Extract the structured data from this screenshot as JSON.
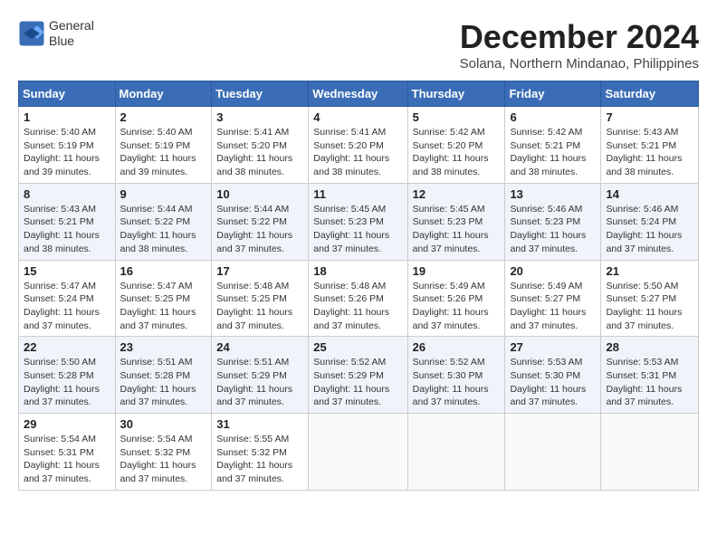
{
  "header": {
    "logo_line1": "General",
    "logo_line2": "Blue",
    "month_year": "December 2024",
    "location": "Solana, Northern Mindanao, Philippines"
  },
  "calendar": {
    "headers": [
      "Sunday",
      "Monday",
      "Tuesday",
      "Wednesday",
      "Thursday",
      "Friday",
      "Saturday"
    ],
    "weeks": [
      [
        {
          "day": "",
          "info": ""
        },
        {
          "day": "2",
          "info": "Sunrise: 5:40 AM\nSunset: 5:19 PM\nDaylight: 11 hours\nand 39 minutes."
        },
        {
          "day": "3",
          "info": "Sunrise: 5:41 AM\nSunset: 5:20 PM\nDaylight: 11 hours\nand 38 minutes."
        },
        {
          "day": "4",
          "info": "Sunrise: 5:41 AM\nSunset: 5:20 PM\nDaylight: 11 hours\nand 38 minutes."
        },
        {
          "day": "5",
          "info": "Sunrise: 5:42 AM\nSunset: 5:20 PM\nDaylight: 11 hours\nand 38 minutes."
        },
        {
          "day": "6",
          "info": "Sunrise: 5:42 AM\nSunset: 5:21 PM\nDaylight: 11 hours\nand 38 minutes."
        },
        {
          "day": "7",
          "info": "Sunrise: 5:43 AM\nSunset: 5:21 PM\nDaylight: 11 hours\nand 38 minutes."
        }
      ],
      [
        {
          "day": "1",
          "info": "Sunrise: 5:40 AM\nSunset: 5:19 PM\nDaylight: 11 hours\nand 39 minutes."
        },
        {
          "day": "",
          "info": ""
        },
        {
          "day": "",
          "info": ""
        },
        {
          "day": "",
          "info": ""
        },
        {
          "day": "",
          "info": ""
        },
        {
          "day": "",
          "info": ""
        },
        {
          "day": "",
          "info": ""
        }
      ],
      [
        {
          "day": "8",
          "info": "Sunrise: 5:43 AM\nSunset: 5:21 PM\nDaylight: 11 hours\nand 38 minutes."
        },
        {
          "day": "9",
          "info": "Sunrise: 5:44 AM\nSunset: 5:22 PM\nDaylight: 11 hours\nand 38 minutes."
        },
        {
          "day": "10",
          "info": "Sunrise: 5:44 AM\nSunset: 5:22 PM\nDaylight: 11 hours\nand 37 minutes."
        },
        {
          "day": "11",
          "info": "Sunrise: 5:45 AM\nSunset: 5:23 PM\nDaylight: 11 hours\nand 37 minutes."
        },
        {
          "day": "12",
          "info": "Sunrise: 5:45 AM\nSunset: 5:23 PM\nDaylight: 11 hours\nand 37 minutes."
        },
        {
          "day": "13",
          "info": "Sunrise: 5:46 AM\nSunset: 5:23 PM\nDaylight: 11 hours\nand 37 minutes."
        },
        {
          "day": "14",
          "info": "Sunrise: 5:46 AM\nSunset: 5:24 PM\nDaylight: 11 hours\nand 37 minutes."
        }
      ],
      [
        {
          "day": "15",
          "info": "Sunrise: 5:47 AM\nSunset: 5:24 PM\nDaylight: 11 hours\nand 37 minutes."
        },
        {
          "day": "16",
          "info": "Sunrise: 5:47 AM\nSunset: 5:25 PM\nDaylight: 11 hours\nand 37 minutes."
        },
        {
          "day": "17",
          "info": "Sunrise: 5:48 AM\nSunset: 5:25 PM\nDaylight: 11 hours\nand 37 minutes."
        },
        {
          "day": "18",
          "info": "Sunrise: 5:48 AM\nSunset: 5:26 PM\nDaylight: 11 hours\nand 37 minutes."
        },
        {
          "day": "19",
          "info": "Sunrise: 5:49 AM\nSunset: 5:26 PM\nDaylight: 11 hours\nand 37 minutes."
        },
        {
          "day": "20",
          "info": "Sunrise: 5:49 AM\nSunset: 5:27 PM\nDaylight: 11 hours\nand 37 minutes."
        },
        {
          "day": "21",
          "info": "Sunrise: 5:50 AM\nSunset: 5:27 PM\nDaylight: 11 hours\nand 37 minutes."
        }
      ],
      [
        {
          "day": "22",
          "info": "Sunrise: 5:50 AM\nSunset: 5:28 PM\nDaylight: 11 hours\nand 37 minutes."
        },
        {
          "day": "23",
          "info": "Sunrise: 5:51 AM\nSunset: 5:28 PM\nDaylight: 11 hours\nand 37 minutes."
        },
        {
          "day": "24",
          "info": "Sunrise: 5:51 AM\nSunset: 5:29 PM\nDaylight: 11 hours\nand 37 minutes."
        },
        {
          "day": "25",
          "info": "Sunrise: 5:52 AM\nSunset: 5:29 PM\nDaylight: 11 hours\nand 37 minutes."
        },
        {
          "day": "26",
          "info": "Sunrise: 5:52 AM\nSunset: 5:30 PM\nDaylight: 11 hours\nand 37 minutes."
        },
        {
          "day": "27",
          "info": "Sunrise: 5:53 AM\nSunset: 5:30 PM\nDaylight: 11 hours\nand 37 minutes."
        },
        {
          "day": "28",
          "info": "Sunrise: 5:53 AM\nSunset: 5:31 PM\nDaylight: 11 hours\nand 37 minutes."
        }
      ],
      [
        {
          "day": "29",
          "info": "Sunrise: 5:54 AM\nSunset: 5:31 PM\nDaylight: 11 hours\nand 37 minutes."
        },
        {
          "day": "30",
          "info": "Sunrise: 5:54 AM\nSunset: 5:32 PM\nDaylight: 11 hours\nand 37 minutes."
        },
        {
          "day": "31",
          "info": "Sunrise: 5:55 AM\nSunset: 5:32 PM\nDaylight: 11 hours\nand 37 minutes."
        },
        {
          "day": "",
          "info": ""
        },
        {
          "day": "",
          "info": ""
        },
        {
          "day": "",
          "info": ""
        },
        {
          "day": "",
          "info": ""
        }
      ]
    ]
  }
}
